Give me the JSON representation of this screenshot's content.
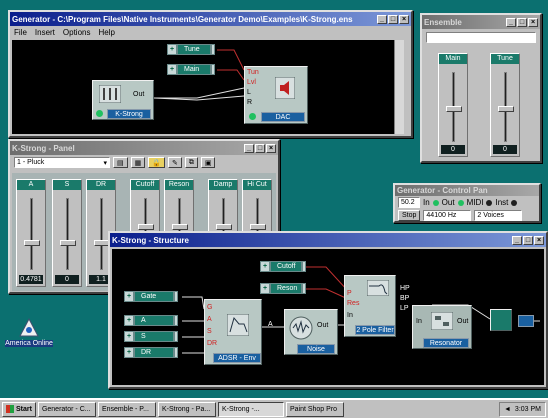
{
  "generator": {
    "title": "Generator - C:\\Program Files\\Native Instruments\\Generator Demo\\Examples\\K-Strong.ens",
    "menu": [
      "File",
      "Insert",
      "Options",
      "Help"
    ],
    "tune": "Tune",
    "main": "Main",
    "kstrong": "K-Strong",
    "out": "Out",
    "dac": "DAC",
    "dac_ports": [
      "Tun",
      "Lvl",
      "L",
      "R"
    ]
  },
  "ensemble": {
    "title": "Ensemble",
    "faders": [
      {
        "label": "Main",
        "value": "0"
      },
      {
        "label": "Tune",
        "value": "0"
      }
    ]
  },
  "panel": {
    "title": "K-Strong - Panel",
    "preset": "1 - Pluck",
    "faders": [
      {
        "label": "A",
        "value": "0.4781"
      },
      {
        "label": "S",
        "value": "0"
      },
      {
        "label": "DR",
        "value": "1.1"
      },
      {
        "label": "Cutoff",
        "value": ""
      },
      {
        "label": "Reson",
        "value": ""
      },
      {
        "label": "Damp",
        "value": ""
      },
      {
        "label": "Hi Cut",
        "value": ""
      }
    ]
  },
  "control": {
    "title": "Generator - Control Pan",
    "counter": "50.2",
    "in": "In",
    "out": "Out",
    "midi": "MIDI",
    "inst": "Inst",
    "stop": "Stop",
    "rate": "44100 Hz",
    "voices": "2 Voices"
  },
  "structure": {
    "title": "K-Strong - Structure",
    "gate": "Gate",
    "a": "A",
    "s": "S",
    "dr": "DR",
    "adsr": "ADSR - Env",
    "adsr_ports": [
      "G",
      "A",
      "S",
      "DR"
    ],
    "adsr_out": "A",
    "noise": "Noise",
    "noise_out": "Out",
    "cutoff": "Cutoff",
    "reson": "Reson",
    "filter": "2 Pole Filter",
    "filter_ports": [
      "P",
      "Res",
      "In"
    ],
    "filter_outs": [
      "HP",
      "BP",
      "LP"
    ],
    "resonator": "Resonator",
    "resonator_in": "In",
    "resonator_out": "Out"
  },
  "desktop": {
    "icon_label": "America Online"
  },
  "taskbar": {
    "start": "Start",
    "buttons": [
      "Generator - C...",
      "Ensemble - P...",
      "K-Strong - Pa...",
      "K-Strong -...",
      "Paint Shop Pro"
    ],
    "clock": "3:03 PM"
  },
  "colors": {
    "desktop": "#0b7070",
    "titlebar": "#0a1e8c",
    "module_teal": "#1a7a6a",
    "tag_blue": "#1a60a0"
  }
}
